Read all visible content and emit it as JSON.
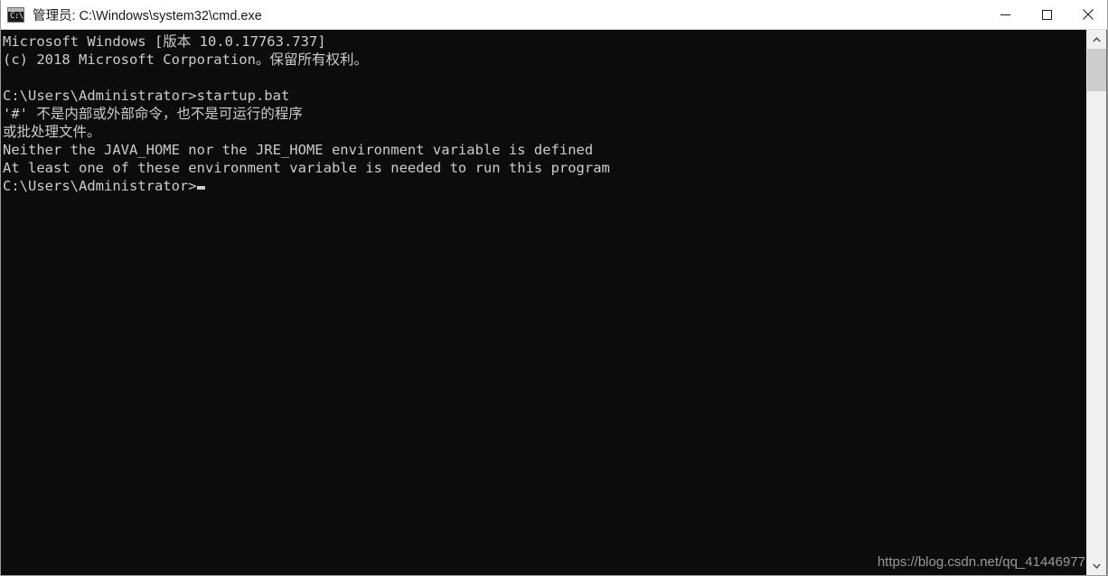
{
  "window": {
    "title": "管理员: C:\\Windows\\system32\\cmd.exe",
    "icon": "cmd-console-icon",
    "icon_text": "C:\\",
    "background_color": "#0c0c0c",
    "text_color": "#cccccc",
    "titlebar_color": "#ffffff"
  },
  "titlebar_buttons": {
    "minimize": "minimize",
    "maximize": "maximize",
    "close": "close"
  },
  "console": {
    "lines": [
      "Microsoft Windows [版本 10.0.17763.737]",
      "(c) 2018 Microsoft Corporation。保留所有权利。",
      "",
      "C:\\Users\\Administrator>startup.bat",
      "'#' 不是内部或外部命令，也不是可运行的程序",
      "或批处理文件。",
      "Neither the JAVA_HOME nor the JRE_HOME environment variable is defined",
      "At least one of these environment variable is needed to run this program"
    ],
    "prompt": "C:\\Users\\Administrator>",
    "cursor": "block-cursor"
  },
  "watermark": {
    "text": "https://blog.csdn.net/qq_41446977"
  },
  "scrollbar": {
    "up_arrow": "scroll-up",
    "down_arrow": "scroll-down",
    "thumb": "scroll-thumb"
  }
}
